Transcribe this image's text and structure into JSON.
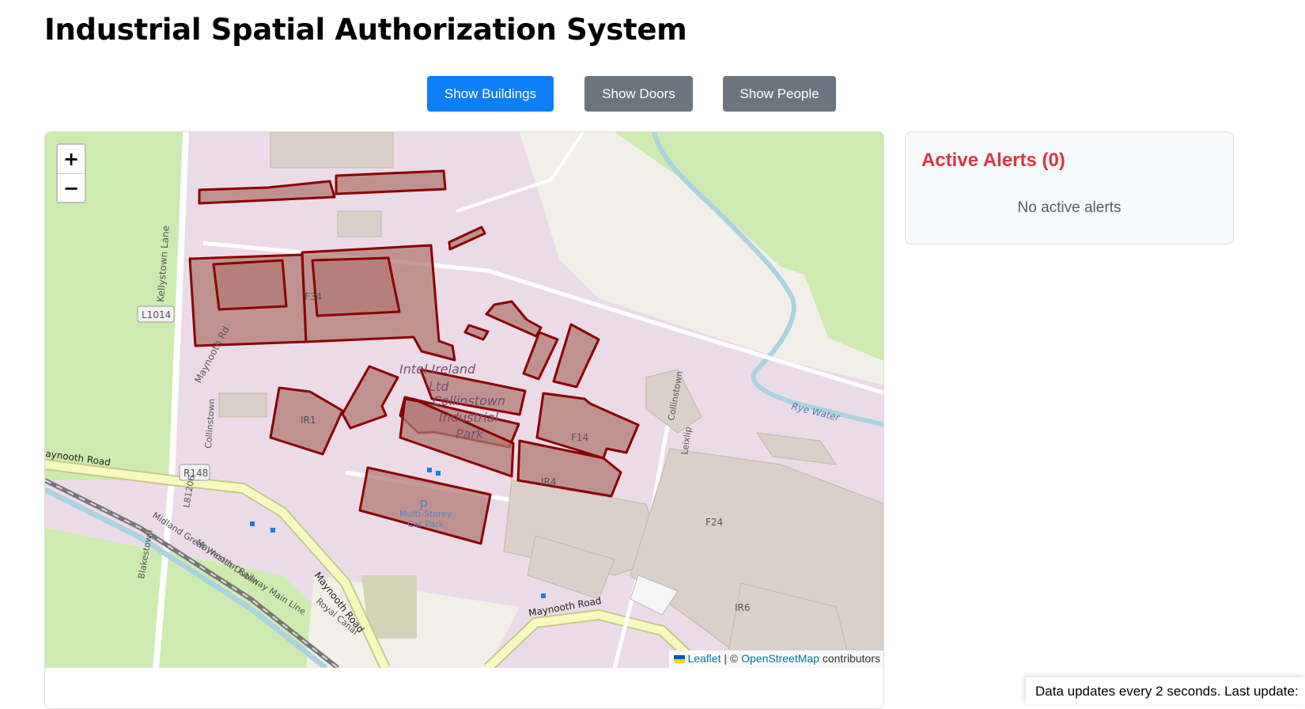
{
  "header": {
    "title": "Industrial Spatial Authorization System"
  },
  "toolbar": {
    "show_buildings": "Show Buildings",
    "show_doors": "Show Doors",
    "show_people": "Show People"
  },
  "map": {
    "zoom_in": "+",
    "zoom_out": "−",
    "attribution": {
      "leaflet": "Leaflet",
      "separator": "| ©",
      "osm": "OpenStreetMap",
      "contributors": "contributors"
    },
    "labels": {
      "l1014": "L1014",
      "r148": "R148",
      "kellystown_lane": "Kellystown Lane",
      "maynooth_road_w": "aynooth Road",
      "maynooth_road_diag": "Maynooth Road",
      "maynooth_road_s": "Maynooth Road",
      "maynooth_rd": "Maynooth Rd",
      "railway": "Midland Great Western Railway Main Line",
      "royal_canal": "Royal Canal",
      "maynooth_dublin": "Maynooth-Dublin",
      "blakestown": "Blakestown",
      "collinstown_w": "Collinstown",
      "collinstown_e": "Collinstown",
      "leixlip": "Leixlip",
      "rye_water": "Rye Water",
      "l81206": "L81206",
      "intel_1": "Intel Ireland",
      "intel_2": "Ltd",
      "park_1": "Collinstown",
      "park_2": "Industrial",
      "park_3": "Park",
      "ir1": "IR1",
      "ir4": "IR4",
      "ir6": "IR6",
      "f14": "F14",
      "f24": "F24",
      "f34": "F34",
      "parking_p": "P",
      "car_park_1": "Multi-Storey",
      "car_park_2": "Car Park"
    },
    "colors": {
      "industrial": "#ebdbe8",
      "grass": "#cdebb0",
      "building_osm": "#d9d0c9",
      "overlay_fill": "#b07a72",
      "overlay_stroke": "#8b0000",
      "river": "#aad3df",
      "road_yellow": "#f7fabf",
      "road_outline": "#c8c88a",
      "door_marker": "#1a7fe0"
    }
  },
  "alerts": {
    "title": "Active Alerts (0)",
    "empty": "No active alerts"
  },
  "status": {
    "text": "Data updates every 2 seconds. Last update:"
  }
}
